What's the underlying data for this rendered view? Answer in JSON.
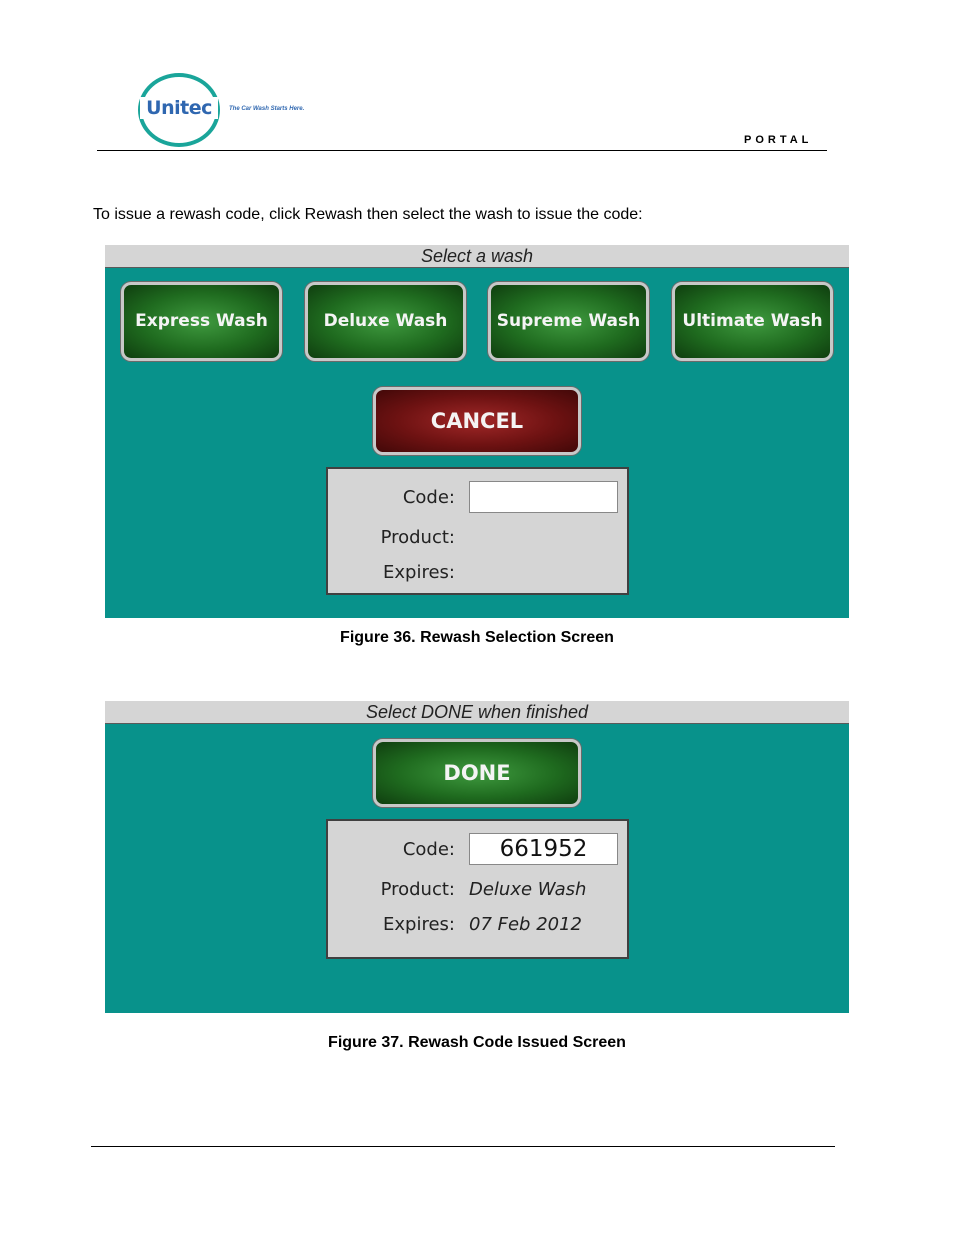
{
  "header": {
    "logo_text": "Unitec",
    "tagline": "The Car Wash Starts Here.",
    "section_label": "PORTAL"
  },
  "intro_text": "To issue a rewash code, click Rewash then select the wash to issue the code:",
  "figure36": {
    "bar_title": "Select a wash",
    "wash_buttons": [
      "Express Wash",
      "Deluxe Wash",
      "Supreme Wash",
      "Ultimate Wash"
    ],
    "cancel_label": "CANCEL",
    "code_label": "Code:",
    "product_label": "Product:",
    "expires_label": "Expires:",
    "code_value": "",
    "caption": "Figure 36. Rewash Selection Screen"
  },
  "figure37": {
    "bar_title": "Select DONE when finished",
    "done_label": "DONE",
    "code_label": "Code:",
    "product_label": "Product:",
    "expires_label": "Expires:",
    "code_value": "661952",
    "product_value": "Deluxe Wash",
    "expires_value": "07 Feb 2012",
    "caption": "Figure 37. Rewash Code Issued Screen"
  },
  "colors": {
    "screen_teal": "#08928b",
    "bar_gray": "#d5d5d5",
    "button_green": "#1f6b1f",
    "button_red": "#6e1212",
    "logo_ring": "#1aa59a",
    "logo_text": "#2f67b0"
  }
}
